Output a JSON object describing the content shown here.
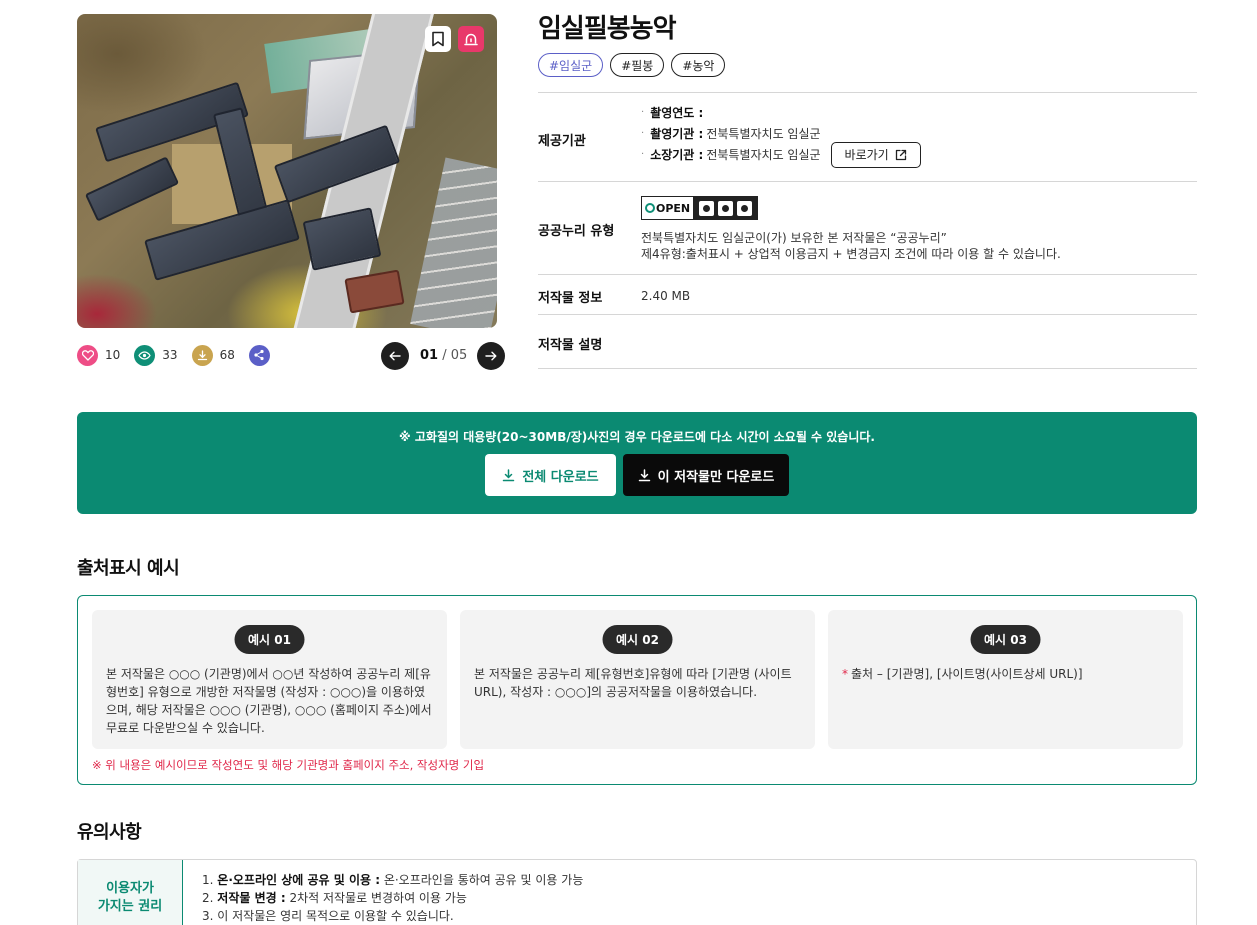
{
  "artwork": {
    "title": "임실필봉농악",
    "tags": [
      "#임실군",
      "#필봉",
      "#농악"
    ],
    "stats": {
      "likes": "10",
      "views": "33",
      "downloads": "68"
    },
    "pager": {
      "current": "01",
      "separator": " / ",
      "total": "05"
    }
  },
  "info": {
    "provider": {
      "label": "제공기관",
      "lines": [
        {
          "key": "촬영연도 :",
          "value": ""
        },
        {
          "key": "촬영기관 :",
          "value": "전북특별자치도 임실군"
        },
        {
          "key": "소장기관 :",
          "value": "전북특별자치도 임실군"
        }
      ],
      "link_label": "바로가기"
    },
    "license": {
      "label": "공공누리 유형",
      "badge_text": "OPEN",
      "line1": "전북특별자치도 임실군이(가) 보유한 본 저작물은 “공공누리”",
      "line2": "제4유형:출처표시 + 상업적 이용금지 + 변경금지 조건에 따라 이용 할 수 있습니다."
    },
    "file": {
      "label": "저작물 정보",
      "value": "2.40 MB"
    },
    "description": {
      "label": "저작물 설명",
      "value": ""
    }
  },
  "download": {
    "notice": "※ 고화질의 대용량(20~30MB/장)사진의 경우 다운로드에 다소 시간이 소요될 수 있습니다.",
    "all_label": "전체 다운로드",
    "one_label": "이 저작물만 다운로드",
    "accent": "#0b8a72"
  },
  "attribution": {
    "title": "출처표시 예시",
    "examples": [
      {
        "badge": "예시 01",
        "text": "본 저작물은 ○○○ (기관명)에서 ○○년 작성하여 공공누리 제[유형번호] 유형으로 개방한 저작물명 (작성자 : ○○○)을 이용하였으며, 해당 저작물은 ○○○ (기관명), ○○○ (홈페이지 주소)에서 무료로 다운받으실 수 있습니다."
      },
      {
        "badge": "예시 02",
        "text": "본 저작물은 공공누리 제[유형번호]유형에 따라 [기관명 (사이트 URL), 작성자 : ○○○]의 공공저작물을 이용하였습니다."
      },
      {
        "badge": "예시 03",
        "star": "*",
        "text": "출처 – [기관명], [사이트명(사이트상세 URL)]"
      }
    ],
    "note": "※ 위 내용은 예시이므로 작성연도 및 해당 기관명과 홈페이지 주소, 작성자명 기입"
  },
  "cautions": {
    "title": "유의사항",
    "side_line1": "이용자가",
    "side_line2": "가지는 권리",
    "items": [
      {
        "num": "1.",
        "bold": "온·오프라인 상에 공유 및 이용 :",
        "text": " 온·오프라인을 통하여 공유 및 이용 가능"
      },
      {
        "num": "2.",
        "bold": "저작물 변경 :",
        "text": " 2차적 저작물로 변경하여 이용 가능"
      },
      {
        "num": "3.",
        "bold": "",
        "text": "이 저작물은 영리 목적으로 이용할 수 있습니다."
      }
    ]
  },
  "colors": {
    "primary_green": "#0b8a72",
    "tag_accent": "#5b5fc7",
    "like_pink": "#ee4d86",
    "alert_pink": "#e8386a",
    "note_red": "#e0284a"
  },
  "icons": [
    "bookmark-icon",
    "siren-icon",
    "heart-icon",
    "eye-icon",
    "download-icon",
    "share-icon",
    "arrow-left-icon",
    "arrow-right-icon",
    "external-link-icon"
  ]
}
